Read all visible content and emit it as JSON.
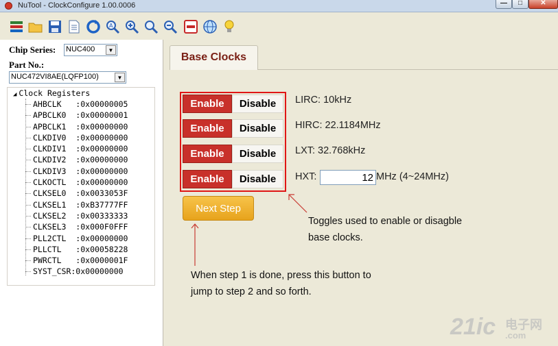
{
  "window": {
    "title": "NuTool - ClockConfigure 1.00.0006",
    "min_label": "—",
    "max_label": "□",
    "close_label": "✕"
  },
  "toolbar": {
    "icons": [
      "layers-icon",
      "folder-open-icon",
      "save-icon",
      "document-icon",
      "refresh-icon",
      "zoom-fit-icon",
      "zoom-in-icon",
      "zoom-icon",
      "zoom-out-icon",
      "remove-icon",
      "globe-icon",
      "lightbulb-icon"
    ]
  },
  "left": {
    "chip_series_label": "Chip Series:",
    "chip_series_value": "NUC400",
    "part_no_label": "Part No.:",
    "part_no_value": "NUC472VI8AE(LQFP100)",
    "tree_root": "Clock Registers",
    "registers": [
      "AHBCLK   :0x00000005",
      "APBCLK0  :0x00000001",
      "APBCLK1  :0x00000000",
      "CLKDIV0  :0x00000000",
      "CLKDIV1  :0x00000000",
      "CLKDIV2  :0x00000000",
      "CLKDIV3  :0x00000000",
      "CLKOCTL  :0x00000000",
      "CLKSEL0  :0x0033053F",
      "CLKSEL1  :0xB37777FF",
      "CLKSEL2  :0x00333333",
      "CLKSEL3  :0x000F0FFF",
      "PLL2CTL  :0x00000000",
      "PLLCTL   :0x00058228",
      "PWRCTL   :0x0000001F",
      "SYST_CSR:0x00000000"
    ]
  },
  "main": {
    "tab_label": "Base Clocks",
    "enable_label": "Enable",
    "disable_label": "Disable",
    "lirc": "LIRC: 10kHz",
    "hirc": "HIRC: 22.1184MHz",
    "lxt": "LXT: 32.768kHz",
    "hxt_label": "HXT:",
    "hxt_value": "12",
    "hxt_unit": "MHz (4~24MHz)",
    "next_step": "Next Step",
    "annotation_toggle": [
      "Toggles used to enable or disagble",
      "base clocks."
    ],
    "annotation_button": [
      "When step 1 is done, press this button to",
      "jump to step 2 and so forth."
    ]
  },
  "watermark": {
    "big": "21ic",
    "cn": "电子网",
    "dot": ".com"
  },
  "colors": {
    "enable_red": "#c8302a",
    "next_step_orange": "#e7a31c",
    "highlight_red": "#e01515",
    "tab_text": "#7a2015"
  }
}
